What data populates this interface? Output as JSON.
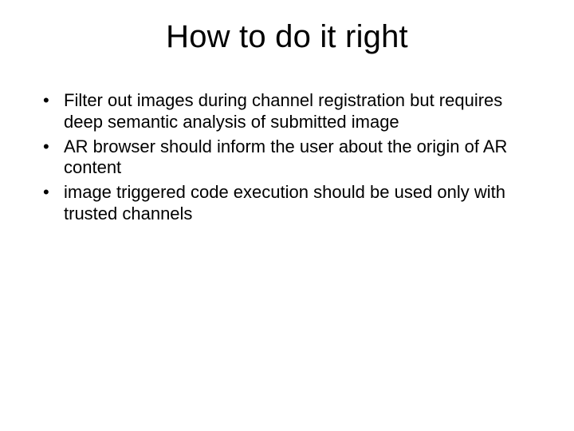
{
  "title": "How to do it right",
  "bullets": [
    "Filter out images during channel registration but requires deep semantic analysis of submitted image",
    "AR browser should inform the user about the origin of AR content",
    "image triggered code execution should be used only with trusted channels"
  ]
}
